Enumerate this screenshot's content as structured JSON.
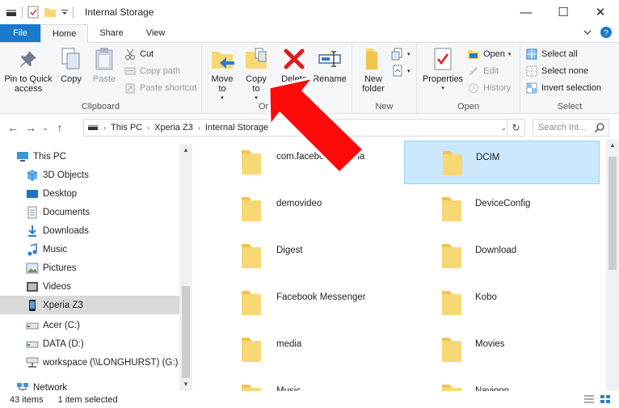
{
  "window": {
    "title": "Internal Storage",
    "controls": {
      "minimize": "—",
      "maximize": "☐",
      "close": "✕"
    }
  },
  "tabs": [
    {
      "label": "File"
    },
    {
      "label": "Home"
    },
    {
      "label": "Share"
    },
    {
      "label": "View"
    }
  ],
  "ribbon": {
    "clipboard": {
      "label": "Clipboard",
      "pin": "Pin to Quick access",
      "copy": "Copy",
      "paste": "Paste",
      "cut": "Cut",
      "copy_path": "Copy path",
      "paste_shortcut": "Paste shortcut"
    },
    "organize": {
      "label": "Org",
      "move_to": "Move to",
      "copy_to": "Copy to",
      "delete": "Delete",
      "rename": "Rename"
    },
    "new": {
      "label": "New",
      "new_folder": "New folder"
    },
    "open": {
      "label": "Open",
      "properties": "Properties",
      "open": "Open",
      "edit": "Edit",
      "history": "History"
    },
    "select": {
      "label": "Select",
      "select_all": "Select all",
      "select_none": "Select none",
      "invert": "Invert selection"
    }
  },
  "address": {
    "crumbs": [
      "This PC",
      "Xperia Z3",
      "Internal Storage"
    ],
    "search_placeholder": "Search Int..."
  },
  "nav_items": [
    {
      "label": "This PC",
      "icon": "pc-icon"
    },
    {
      "label": "3D Objects",
      "icon": "cube-icon"
    },
    {
      "label": "Desktop",
      "icon": "desktop-icon"
    },
    {
      "label": "Documents",
      "icon": "documents-icon"
    },
    {
      "label": "Downloads",
      "icon": "download-icon"
    },
    {
      "label": "Music",
      "icon": "music-icon"
    },
    {
      "label": "Pictures",
      "icon": "pictures-icon"
    },
    {
      "label": "Videos",
      "icon": "videos-icon"
    },
    {
      "label": "Xperia Z3",
      "icon": "phone-icon"
    },
    {
      "label": "Acer (C:)",
      "icon": "drive-icon"
    },
    {
      "label": "DATA (D:)",
      "icon": "drive-icon"
    },
    {
      "label": "workspace (\\\\LONGHURST) (G:)",
      "icon": "network-drive-icon"
    },
    {
      "label": "Network",
      "icon": "network-icon"
    }
  ],
  "folders_left": [
    "com.facebook.katana",
    "demovideo",
    "Digest",
    "Facebook Messenger",
    "media",
    "Music"
  ],
  "folders_right": [
    "DCIM",
    "DeviceConfig",
    "Download",
    "Kobo",
    "Movies",
    "Navigon"
  ],
  "status": {
    "count": "43 items",
    "selected": "1 item selected"
  },
  "colors": {
    "file_tab": "#1979ca",
    "selection": "#cce8ff",
    "folder": "#f8d775",
    "arrow": "#ff0000"
  }
}
